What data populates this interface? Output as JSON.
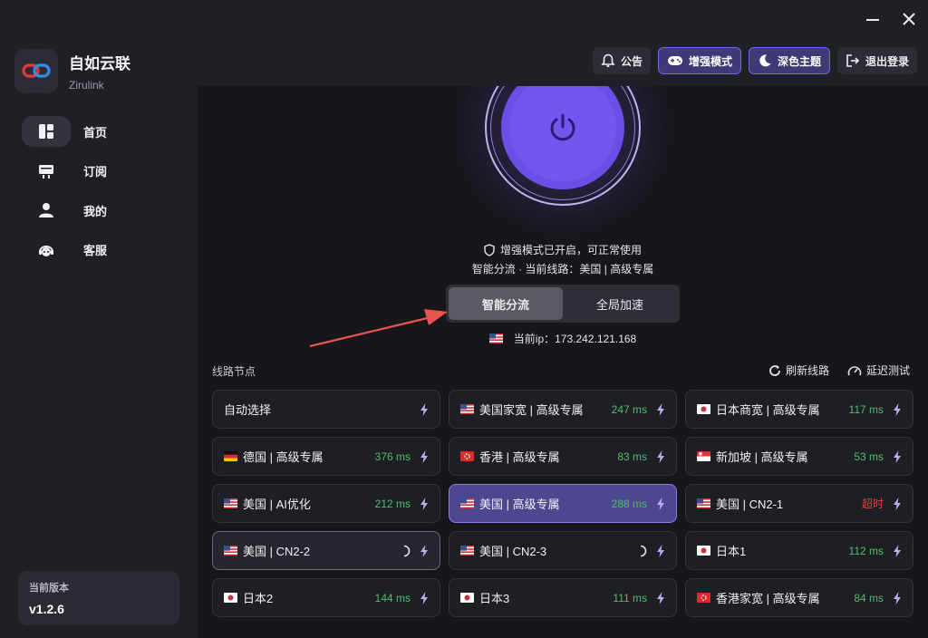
{
  "app": {
    "name": "自如云联",
    "subtitle": "Zirulink"
  },
  "window": {
    "minimize_icon": "minimize-icon",
    "close_icon": "close-icon"
  },
  "nav": {
    "items": [
      {
        "label": "首页",
        "icon": "dashboard-icon",
        "active": true
      },
      {
        "label": "订阅",
        "icon": "subscription-icon",
        "active": false
      },
      {
        "label": "我的",
        "icon": "user-icon",
        "active": false
      },
      {
        "label": "客服",
        "icon": "support-icon",
        "active": false
      }
    ]
  },
  "version": {
    "label": "当前版本",
    "value": "v1.2.6"
  },
  "toolbar": {
    "announce": "公告",
    "enhanced": "增强模式",
    "dark_theme": "深色主题",
    "logout": "退出登录"
  },
  "status": {
    "line1": "增强模式已开启，可正常使用",
    "line2": "智能分流 · 当前线路：美国 | 高级专属"
  },
  "mode": {
    "smart": "智能分流",
    "global": "全局加速",
    "active": "smart"
  },
  "ip": {
    "label": "当前ip：173.242.121.168"
  },
  "nodes_section": {
    "title": "线路节点",
    "refresh": "刷新线路",
    "latency_test": "延迟测试"
  },
  "nodes": [
    {
      "name": "自动选择",
      "ms": "",
      "flag": ""
    },
    {
      "name": "美国家宽 | 高级专属",
      "ms": "247 ms",
      "flag": "us"
    },
    {
      "name": "日本商宽 | 高级专属",
      "ms": "117 ms",
      "flag": "jp"
    },
    {
      "name": "德国 | 高级专属",
      "ms": "376 ms",
      "flag": "de"
    },
    {
      "name": "香港 | 高级专属",
      "ms": "83 ms",
      "flag": "hk"
    },
    {
      "name": "新加坡 | 高级专属",
      "ms": "53 ms",
      "flag": "sg"
    },
    {
      "name": "美国 | AI优化",
      "ms": "212 ms",
      "flag": "us"
    },
    {
      "name": "美国 | 高级专属",
      "ms": "288 ms",
      "flag": "us",
      "selected": true
    },
    {
      "name": "美国 | CN2-1",
      "ms": "超时",
      "flag": "us",
      "timeout": true
    },
    {
      "name": "美国 | CN2-2",
      "ms": "",
      "flag": "us",
      "loading": true,
      "hover": true
    },
    {
      "name": "美国 | CN2-3",
      "ms": "",
      "flag": "us",
      "loading": true
    },
    {
      "name": "日本1",
      "ms": "112 ms",
      "flag": "jp"
    },
    {
      "name": "日本2",
      "ms": "144 ms",
      "flag": "jp"
    },
    {
      "name": "日本3",
      "ms": "111 ms",
      "flag": "jp"
    },
    {
      "name": "香港家宽 | 高级专属",
      "ms": "84 ms",
      "flag": "hk"
    }
  ],
  "colors": {
    "accent": "#6a4ee6",
    "latency_ok": "#4fbf6a",
    "latency_timeout": "#e2483e"
  }
}
